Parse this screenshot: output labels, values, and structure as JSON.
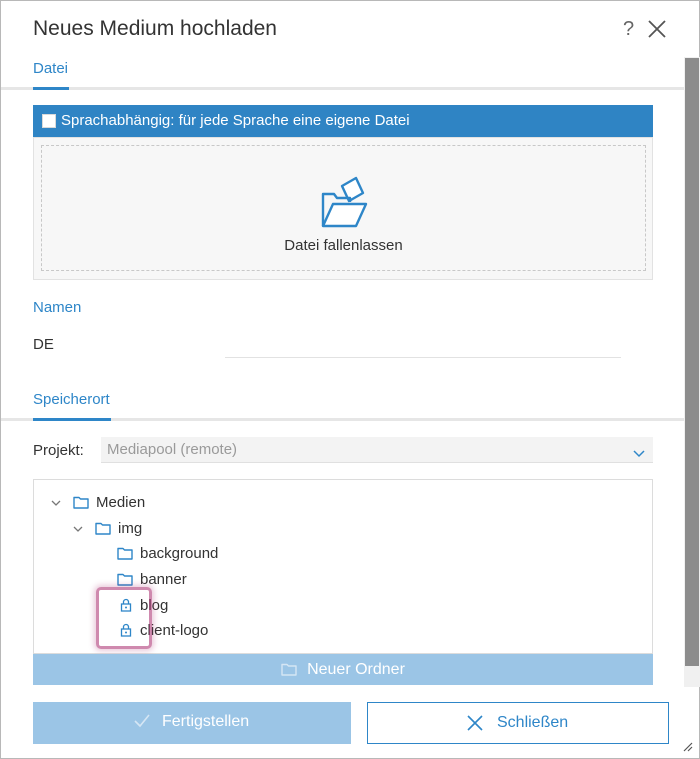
{
  "dialog": {
    "title": "Neues Medium hochladen",
    "help": "?",
    "close_icon": "close-icon"
  },
  "tabs": {
    "datei": "Datei"
  },
  "upload": {
    "language_toggle_label": "Sprachabhängig: für jede Sprache eine eigene Datei",
    "language_toggle_checked": false,
    "drop_label": "Datei fallenlassen",
    "drop_icon": "open-folder-icon"
  },
  "namen": {
    "section_title": "Namen",
    "fields": [
      {
        "label": "DE",
        "value": ""
      }
    ]
  },
  "speicherort": {
    "section_title": "Speicherort",
    "projekt_label": "Projekt:",
    "projekt_value": "Mediapool (remote)",
    "tree": [
      {
        "label": "Medien",
        "icon": "folder-icon",
        "expanded": true
      },
      {
        "label": "img",
        "icon": "folder-icon",
        "expanded": true
      },
      {
        "label": "background",
        "icon": "folder-icon"
      },
      {
        "label": "banner",
        "icon": "folder-icon"
      },
      {
        "label": "blog",
        "icon": "lock-icon"
      },
      {
        "label": "client-logo",
        "icon": "lock-icon"
      }
    ],
    "new_folder_label": "Neuer Ordner"
  },
  "footer": {
    "finish_label": "Fertigstellen",
    "close_label": "Schließen"
  },
  "colors": {
    "accent": "#2e86c8",
    "accent_disabled": "#9bc5e6",
    "highlight": "#a8286c"
  }
}
